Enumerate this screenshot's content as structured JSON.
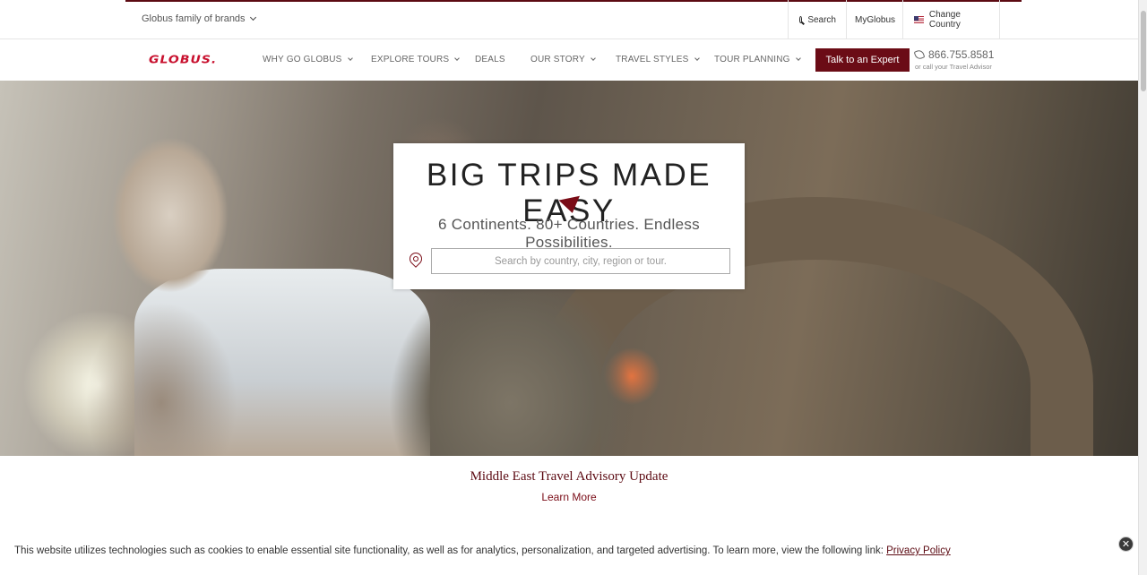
{
  "topbar": {
    "brands_label": "Globus family of brands",
    "search_label": "Search",
    "myglobus_label": "MyGlobus",
    "country_label": "Change Country"
  },
  "nav": {
    "logo": "GLOBUS.",
    "items": [
      {
        "label": "WHY GO GLOBUS",
        "dropdown": true
      },
      {
        "label": "EXPLORE TOURS",
        "dropdown": true
      },
      {
        "label": "DEALS",
        "dropdown": false
      },
      {
        "label": "OUR STORY",
        "dropdown": true
      },
      {
        "label": "TRAVEL STYLES",
        "dropdown": true
      },
      {
        "label": "TOUR PLANNING",
        "dropdown": true
      }
    ],
    "cta_label": "Talk to an Expert",
    "phone_number": "866.755.8581",
    "phone_sub": "or call your Travel Advisor"
  },
  "hero": {
    "title": "BIG TRIPS MADE EASY",
    "subtitle": "6 Continents. 80+ Countries. Endless Possibilities.",
    "search_placeholder": "Search by country, city, region or tour."
  },
  "advisory": {
    "title": "Middle East Travel Advisory Update",
    "link": "Learn More"
  },
  "cookie": {
    "text": "This website utilizes technologies such as cookies to enable essential site functionality, as well as for analytics, personalization, and targeted advertising. To learn more, view the following link: ",
    "link": "Privacy Policy",
    "close": "✕"
  },
  "colors": {
    "brand_red": "#c8102e",
    "accent_maroon": "#6b0c16"
  }
}
